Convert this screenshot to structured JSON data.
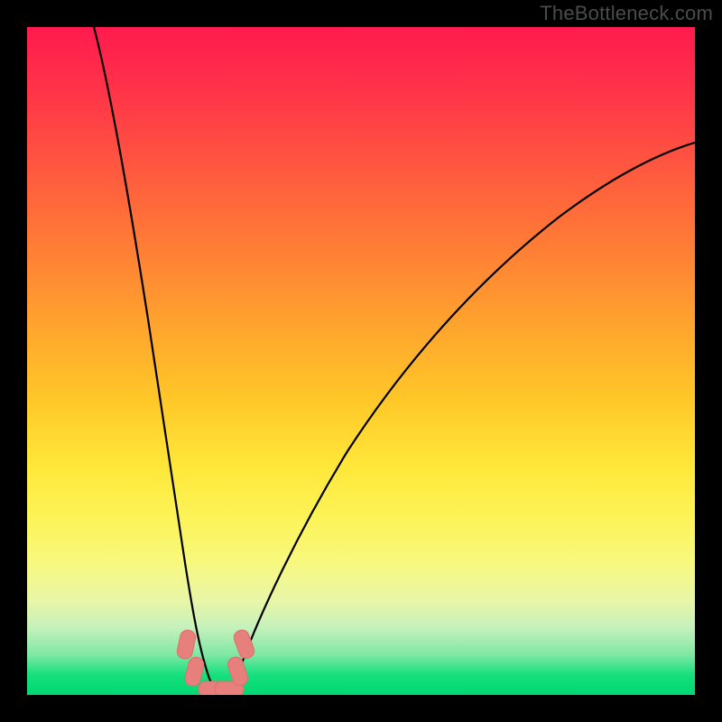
{
  "watermark": "TheBottleneck.com",
  "chart_data": {
    "type": "line",
    "title": "",
    "xlabel": "",
    "ylabel": "",
    "xlim": [
      0,
      100
    ],
    "ylim": [
      0,
      100
    ],
    "grid": false,
    "legend": false,
    "series": [
      {
        "name": "left-curve",
        "x": [
          10,
          12,
          14,
          16,
          18,
          20,
          22,
          23.5,
          25,
          27,
          29
        ],
        "y": [
          100,
          85,
          70,
          55,
          40,
          27,
          15,
          7,
          2,
          0,
          0
        ]
      },
      {
        "name": "right-curve",
        "x": [
          29,
          30,
          31,
          33,
          36,
          40,
          45,
          52,
          60,
          70,
          82,
          95,
          100
        ],
        "y": [
          0,
          0,
          2,
          6,
          13,
          22,
          32,
          43,
          53,
          63,
          72,
          80,
          83
        ]
      }
    ],
    "markers": [
      {
        "name": "marker-left-upper",
        "cx": 24.0,
        "cy": 7.0
      },
      {
        "name": "marker-left-lower",
        "cx": 25.0,
        "cy": 2.0
      },
      {
        "name": "marker-bottom-a",
        "cx": 27.0,
        "cy": 0.0
      },
      {
        "name": "marker-bottom-b",
        "cx": 29.5,
        "cy": 0.0
      },
      {
        "name": "marker-right-lower",
        "cx": 31.0,
        "cy": 3.5
      },
      {
        "name": "marker-right-upper",
        "cx": 32.0,
        "cy": 7.5
      }
    ],
    "gradient_stops": [
      {
        "pos": 0.0,
        "color": "#ff1b4e"
      },
      {
        "pos": 0.5,
        "color": "#ffc828"
      },
      {
        "pos": 0.8,
        "color": "#f8f87e"
      },
      {
        "pos": 1.0,
        "color": "#00d873"
      }
    ]
  }
}
